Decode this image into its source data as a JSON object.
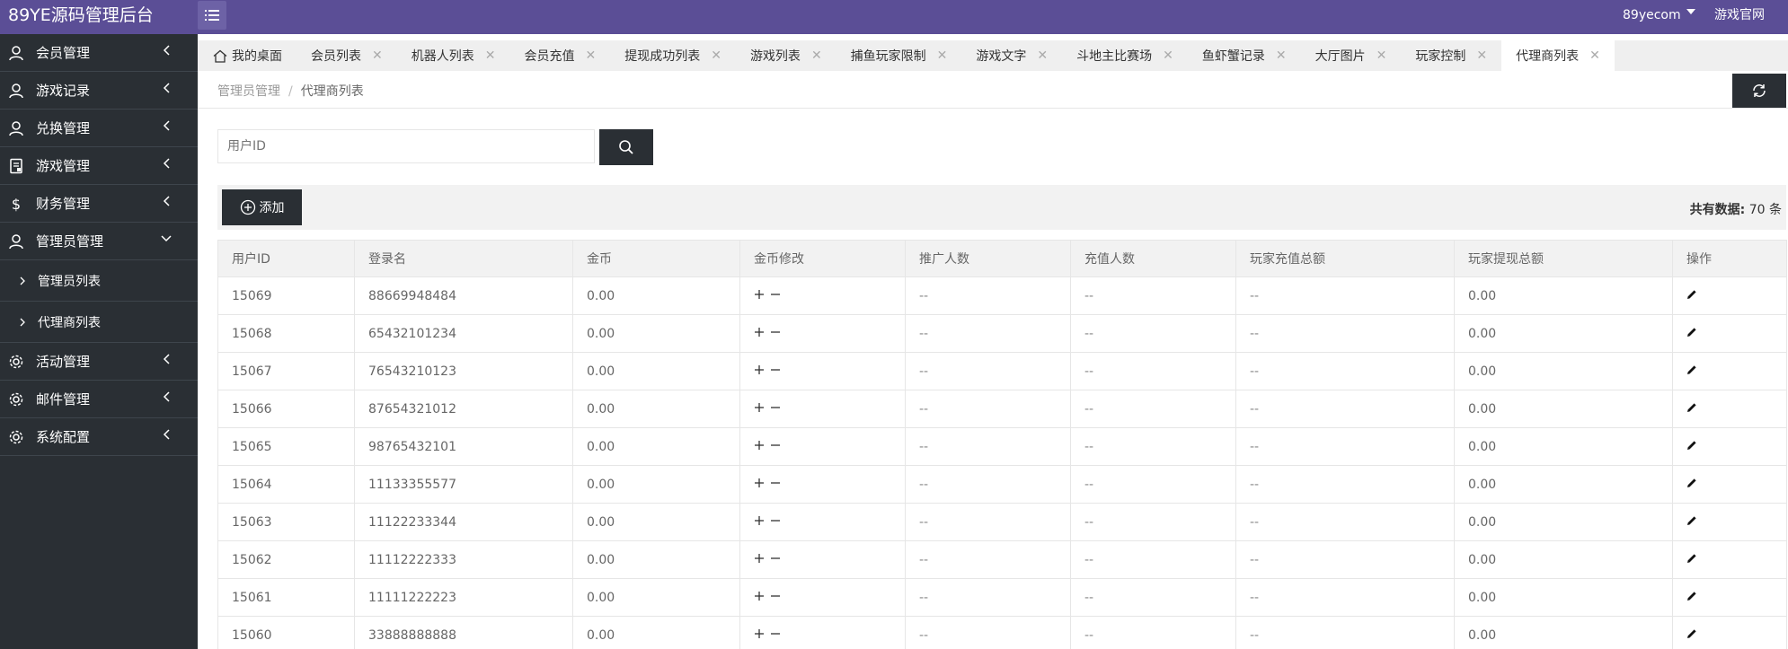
{
  "header": {
    "brand": "89YE源码管理后台",
    "user": "89yecom",
    "official_link": "游戏官网"
  },
  "sidebar": {
    "items": [
      {
        "label": "会员管理",
        "icon": "user-icon"
      },
      {
        "label": "游戏记录",
        "icon": "user-icon"
      },
      {
        "label": "兑换管理",
        "icon": "user-icon"
      },
      {
        "label": "游戏管理",
        "icon": "document-icon"
      },
      {
        "label": "财务管理",
        "icon": "dollar-icon"
      },
      {
        "label": "管理员管理",
        "icon": "user-icon",
        "expanded": true
      },
      {
        "label": "活动管理",
        "icon": "gear-icon"
      },
      {
        "label": "邮件管理",
        "icon": "gear-icon"
      },
      {
        "label": "系统配置",
        "icon": "gear-icon"
      }
    ],
    "subitems": [
      {
        "label": "管理员列表"
      },
      {
        "label": "代理商列表"
      }
    ]
  },
  "tabs": [
    {
      "label": "我的桌面"
    },
    {
      "label": "会员列表"
    },
    {
      "label": "机器人列表"
    },
    {
      "label": "会员充值"
    },
    {
      "label": "提现成功列表"
    },
    {
      "label": "游戏列表"
    },
    {
      "label": "捕鱼玩家限制"
    },
    {
      "label": "游戏文字"
    },
    {
      "label": "斗地主比赛场"
    },
    {
      "label": "鱼虾蟹记录"
    },
    {
      "label": "大厅图片"
    },
    {
      "label": "玩家控制"
    },
    {
      "label": "代理商列表",
      "active": true
    }
  ],
  "breadcrumb": {
    "parent": "管理员管理",
    "separator": "/",
    "current": "代理商列表"
  },
  "search": {
    "placeholder": "用户ID"
  },
  "toolbar": {
    "add_label": "添加",
    "total_label": "共有数据:",
    "total_value": "70 条"
  },
  "table": {
    "columns": [
      "用户ID",
      "登录名",
      "金币",
      "金币修改",
      "推广人数",
      "充值人数",
      "玩家充值总额",
      "玩家提现总额",
      "操作"
    ],
    "rows": [
      {
        "id": "15069",
        "login": "88669948484",
        "gold": "0.00",
        "promo": "--",
        "recharge_count": "--",
        "recharge_total": "--",
        "withdraw_total": "0.00"
      },
      {
        "id": "15068",
        "login": "65432101234",
        "gold": "0.00",
        "promo": "--",
        "recharge_count": "--",
        "recharge_total": "--",
        "withdraw_total": "0.00"
      },
      {
        "id": "15067",
        "login": "76543210123",
        "gold": "0.00",
        "promo": "--",
        "recharge_count": "--",
        "recharge_total": "--",
        "withdraw_total": "0.00"
      },
      {
        "id": "15066",
        "login": "87654321012",
        "gold": "0.00",
        "promo": "--",
        "recharge_count": "--",
        "recharge_total": "--",
        "withdraw_total": "0.00"
      },
      {
        "id": "15065",
        "login": "98765432101",
        "gold": "0.00",
        "promo": "--",
        "recharge_count": "--",
        "recharge_total": "--",
        "withdraw_total": "0.00"
      },
      {
        "id": "15064",
        "login": "11133355577",
        "gold": "0.00",
        "promo": "--",
        "recharge_count": "--",
        "recharge_total": "--",
        "withdraw_total": "0.00"
      },
      {
        "id": "15063",
        "login": "11122233344",
        "gold": "0.00",
        "promo": "--",
        "recharge_count": "--",
        "recharge_total": "--",
        "withdraw_total": "0.00"
      },
      {
        "id": "15062",
        "login": "11112222333",
        "gold": "0.00",
        "promo": "--",
        "recharge_count": "--",
        "recharge_total": "--",
        "withdraw_total": "0.00"
      },
      {
        "id": "15061",
        "login": "11111222223",
        "gold": "0.00",
        "promo": "--",
        "recharge_count": "--",
        "recharge_total": "--",
        "withdraw_total": "0.00"
      },
      {
        "id": "15060",
        "login": "33888888888",
        "gold": "0.00",
        "promo": "--",
        "recharge_count": "--",
        "recharge_total": "--",
        "withdraw_total": "0.00"
      }
    ]
  },
  "colors": {
    "header_bg": "#5b4e96",
    "sidebar_bg": "#2a2f34",
    "dark_button": "#2a2f34"
  }
}
